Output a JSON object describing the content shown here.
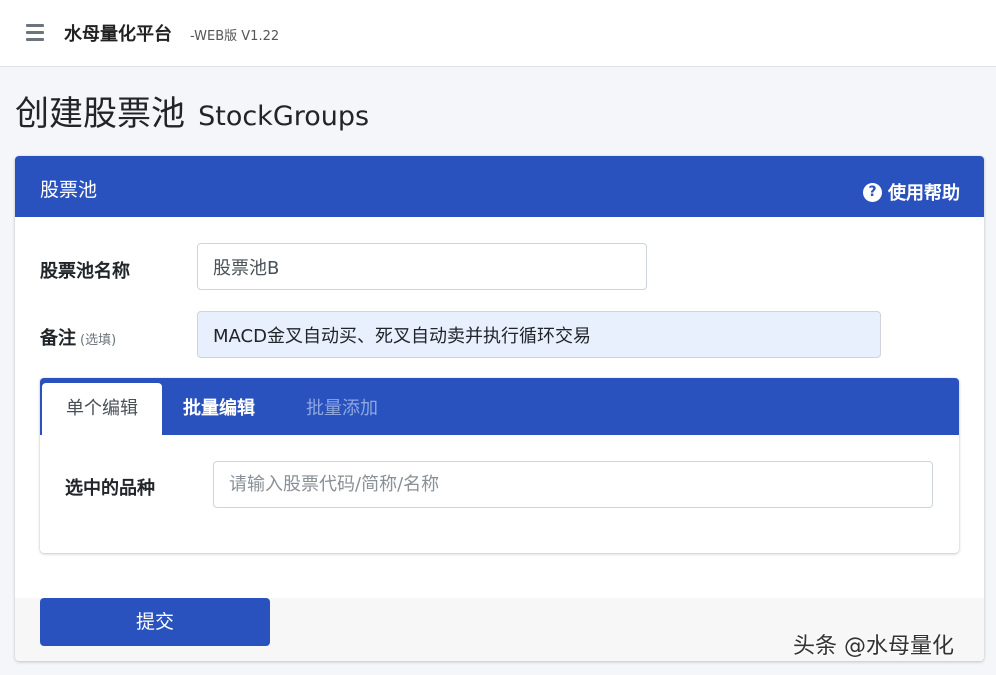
{
  "navbar": {
    "menu_icon": "hamburger-menu-icon",
    "brand_title": "水母量化平台",
    "brand_version": "-WEB版 V1.22"
  },
  "page": {
    "title_cn": "创建股票池",
    "title_en": "StockGroups"
  },
  "card": {
    "title": "股票池",
    "help_icon": "question-circle-icon",
    "help_label": "使用帮助"
  },
  "form": {
    "name_label": "股票池名称",
    "name_value": "股票池B",
    "remark_label": "备注",
    "remark_optional": "(选填)",
    "remark_value": "MACD金叉自动买、死叉自动卖并执行循环交易"
  },
  "tabs": {
    "items": [
      "单个编辑",
      "批量编辑",
      "批量添加"
    ],
    "active": "单个编辑"
  },
  "single_edit": {
    "selected_label": "选中的品种",
    "search_placeholder": "请输入股票代码/简称/名称"
  },
  "footer": {
    "submit_label": "提交"
  },
  "watermark": "头条 @水母量化",
  "colors": {
    "primary": "#2a52be",
    "background": "#f4f6f9",
    "autofill_input": "#e8f0fe",
    "disabled_tab": "#8ea7e3"
  }
}
